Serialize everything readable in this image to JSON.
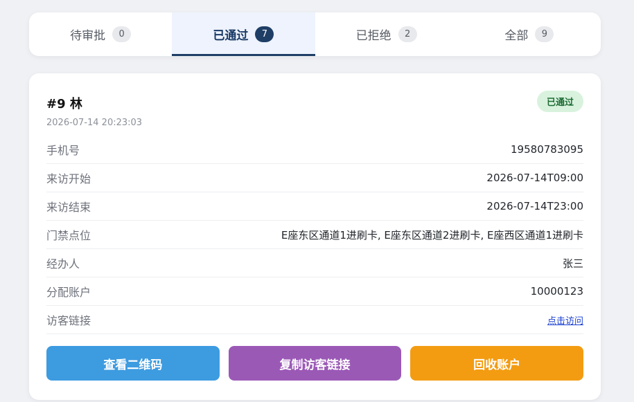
{
  "tabs": [
    {
      "label": "待审批",
      "count": "0"
    },
    {
      "label": "已通过",
      "count": "7"
    },
    {
      "label": "已拒绝",
      "count": "2"
    },
    {
      "label": "全部",
      "count": "9"
    }
  ],
  "active_tab_index": 1,
  "record": {
    "title": "#9 林",
    "created_at": "2026-07-14 20:23:03",
    "status": "已通过",
    "status_color": "#1e6b34",
    "fields": [
      {
        "label": "手机号",
        "value": "19580783095"
      },
      {
        "label": "来访开始",
        "value": "2026-07-14T09:00"
      },
      {
        "label": "来访结束",
        "value": "2026-07-14T23:00"
      },
      {
        "label": "门禁点位",
        "value": "E座东区通道1进刷卡, E座东区通道2进刷卡, E座西区通道1进刷卡"
      },
      {
        "label": "经办人",
        "value": "张三"
      },
      {
        "label": "分配账户",
        "value": "10000123"
      },
      {
        "label": "访客链接",
        "value": "点击访问"
      }
    ]
  },
  "actions": [
    {
      "label": "查看二维码",
      "color": "#3d9be0"
    },
    {
      "label": "复制访客链接",
      "color": "#9b59b6"
    },
    {
      "label": "回收账户",
      "color": "#f39c12"
    }
  ]
}
